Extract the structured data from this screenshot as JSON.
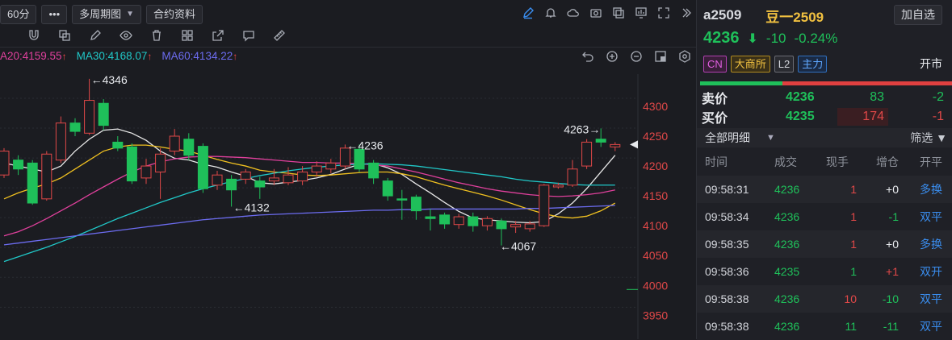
{
  "toolbar": {
    "period": "60分",
    "more": "•••",
    "multi_period": "多周期图",
    "contract_info": "合约资料"
  },
  "ma": [
    {
      "label": "A20:4159.55",
      "color": "#e0409c"
    },
    {
      "label": "MA30:4168.07",
      "color": "#20c8c8"
    },
    {
      "label": "MA60:4134.22",
      "color": "#6c6cf0"
    }
  ],
  "annotations": {
    "high": "←4346",
    "mark_4236": "←4236",
    "mark_4132": "←4132",
    "mark_4067": "←4067",
    "mark_4263": "4263→"
  },
  "chart_data": {
    "type": "candlestick",
    "yticks": [
      4300,
      4250,
      4200,
      4150,
      4100,
      4050,
      4000,
      3950
    ],
    "ylim": [
      3910,
      4362
    ],
    "candles": [
      {
        "o": 4185,
        "c": 4225,
        "h": 4230,
        "l": 4180
      },
      {
        "o": 4210,
        "c": 4195,
        "h": 4218,
        "l": 4185
      },
      {
        "o": 4205,
        "c": 4138,
        "h": 4210,
        "l": 4135
      },
      {
        "o": 4145,
        "c": 4220,
        "h": 4225,
        "l": 4142
      },
      {
        "o": 4210,
        "c": 4272,
        "h": 4283,
        "l": 4205
      },
      {
        "o": 4272,
        "c": 4258,
        "h": 4280,
        "l": 4250
      },
      {
        "o": 4255,
        "c": 4310,
        "h": 4346,
        "l": 4252
      },
      {
        "o": 4305,
        "c": 4268,
        "h": 4312,
        "l": 4260
      },
      {
        "o": 4240,
        "c": 4230,
        "h": 4250,
        "l": 4225
      },
      {
        "o": 4232,
        "c": 4175,
        "h": 4238,
        "l": 4170
      },
      {
        "o": 4180,
        "c": 4200,
        "h": 4212,
        "l": 4170
      },
      {
        "o": 4190,
        "c": 4220,
        "h": 4230,
        "l": 4145
      },
      {
        "o": 4225,
        "c": 4250,
        "h": 4262,
        "l": 4218
      },
      {
        "o": 4245,
        "c": 4218,
        "h": 4255,
        "l": 4210
      },
      {
        "o": 4233,
        "c": 4162,
        "h": 4238,
        "l": 4155
      },
      {
        "o": 4168,
        "c": 4185,
        "h": 4192,
        "l": 4160
      },
      {
        "o": 4178,
        "c": 4160,
        "h": 4185,
        "l": 4132
      },
      {
        "o": 4178,
        "c": 4190,
        "h": 4195,
        "l": 4170
      },
      {
        "o": 4175,
        "c": 4165,
        "h": 4182,
        "l": 4145
      },
      {
        "o": 4175,
        "c": 4180,
        "h": 4195,
        "l": 4168
      },
      {
        "o": 4172,
        "c": 4185,
        "h": 4198,
        "l": 4168
      },
      {
        "o": 4175,
        "c": 4190,
        "h": 4200,
        "l": 4168
      },
      {
        "o": 4190,
        "c": 4200,
        "h": 4208,
        "l": 4182
      },
      {
        "o": 4195,
        "c": 4205,
        "h": 4212,
        "l": 4188
      },
      {
        "o": 4200,
        "c": 4230,
        "h": 4236,
        "l": 4195
      },
      {
        "o": 4228,
        "c": 4195,
        "h": 4236,
        "l": 4190
      },
      {
        "o": 4205,
        "c": 4180,
        "h": 4210,
        "l": 4170
      },
      {
        "o": 4175,
        "c": 4150,
        "h": 4180,
        "l": 4142
      },
      {
        "o": 4145,
        "c": 4143,
        "h": 4160,
        "l": 4110
      },
      {
        "o": 4148,
        "c": 4125,
        "h": 4152,
        "l": 4110
      },
      {
        "o": 4115,
        "c": 4112,
        "h": 4128,
        "l": 4092
      },
      {
        "o": 4118,
        "c": 4103,
        "h": 4122,
        "l": 4095
      },
      {
        "o": 4102,
        "c": 4115,
        "h": 4120,
        "l": 4095
      },
      {
        "o": 4115,
        "c": 4100,
        "h": 4122,
        "l": 4090
      },
      {
        "o": 4100,
        "c": 4112,
        "h": 4116,
        "l": 4092
      },
      {
        "o": 4108,
        "c": 4095,
        "h": 4112,
        "l": 4067
      },
      {
        "o": 4098,
        "c": 4102,
        "h": 4108,
        "l": 4088
      },
      {
        "o": 4095,
        "c": 4103,
        "h": 4108,
        "l": 4090
      },
      {
        "o": 4100,
        "c": 4168,
        "h": 4170,
        "l": 4098
      },
      {
        "o": 4165,
        "c": 4168,
        "h": 4172,
        "l": 4162
      },
      {
        "o": 4168,
        "c": 4195,
        "h": 4210,
        "l": 4165
      },
      {
        "o": 4200,
        "c": 4240,
        "h": 4245,
        "l": 4195
      },
      {
        "o": 4245,
        "c": 4240,
        "h": 4263,
        "l": 4232
      },
      {
        "o": 4232,
        "c": 4236,
        "h": 4240,
        "l": 4225
      }
    ],
    "ma_series": [
      {
        "name": "MA5",
        "color": "#e8e8e8",
        "values": [
          4205,
          4200,
          4195,
          4190,
          4200,
          4225,
          4245,
          4260,
          4262,
          4255,
          4243,
          4225,
          4213,
          4210,
          4203,
          4198,
          4190,
          4183,
          4172,
          4170,
          4173,
          4176,
          4180,
          4186,
          4195,
          4203,
          4204,
          4197,
          4186,
          4170,
          4155,
          4139,
          4124,
          4113,
          4110,
          4108,
          4106,
          4105,
          4107,
          4120,
          4138,
          4162,
          4190,
          4218
        ]
      },
      {
        "name": "MA10",
        "color": "#f0c020",
        "values": [
          4145,
          4155,
          4163,
          4170,
          4180,
          4195,
          4210,
          4225,
          4232,
          4235,
          4235,
          4232,
          4228,
          4225,
          4218,
          4211,
          4205,
          4200,
          4193,
          4190,
          4188,
          4185,
          4184,
          4185,
          4187,
          4189,
          4190,
          4190,
          4187,
          4182,
          4175,
          4168,
          4162,
          4156,
          4150,
          4143,
          4135,
          4127,
          4120,
          4115,
          4113,
          4116,
          4125,
          4138
        ]
      },
      {
        "name": "MA20",
        "color": "#e0409c",
        "values": [
          4083,
          4090,
          4100,
          4112,
          4125,
          4138,
          4152,
          4165,
          4178,
          4190,
          4200,
          4207,
          4212,
          4215,
          4216,
          4216,
          4215,
          4214,
          4212,
          4210,
          4208,
          4206,
          4206,
          4205,
          4205,
          4204,
          4202,
          4200,
          4195,
          4190,
          4184,
          4178,
          4172,
          4167,
          4162,
          4158,
          4155,
          4152,
          4150,
          4149,
          4150,
          4152,
          4155,
          4160
        ]
      },
      {
        "name": "MA30",
        "color": "#20c8c8",
        "values": [
          4040,
          4048,
          4056,
          4064,
          4073,
          4082,
          4092,
          4102,
          4112,
          4121,
          4130,
          4139,
          4147,
          4155,
          4162,
          4168,
          4174,
          4179,
          4184,
          4188,
          4192,
          4195,
          4198,
          4200,
          4202,
          4203,
          4204,
          4203,
          4202,
          4200,
          4197,
          4194,
          4191,
          4188,
          4185,
          4182,
          4178,
          4175,
          4173,
          4171,
          4169,
          4168,
          4168,
          4168
        ]
      },
      {
        "name": "MA60",
        "color": "#6c6cf0",
        "values": [
          4068,
          4071,
          4074,
          4077,
          4080,
          4083,
          4086,
          4089,
          4092,
          4095,
          4098,
          4101,
          4104,
          4107,
          4110,
          4112,
          4114,
          4116,
          4118,
          4119,
          4120,
          4121,
          4122,
          4123,
          4124,
          4125,
          4126,
          4126,
          4127,
          4127,
          4128,
          4128,
          4128,
          4128,
          4128,
          4128,
          4128,
          4129,
          4129,
          4130,
          4131,
          4132,
          4133,
          4134
        ]
      }
    ]
  },
  "side": {
    "code": "a2509",
    "name": "豆一2509",
    "add_watch": "加自选",
    "last_price": "4236",
    "change": "-10",
    "change_pct": "-0.24%",
    "tags": {
      "cn": "CN",
      "exchange": "大商所",
      "level": "L2",
      "main": "主力"
    },
    "market_status": "开市",
    "ask": {
      "label": "卖价",
      "price": "4236",
      "volume": "83",
      "change": "-2"
    },
    "bid": {
      "label": "买价",
      "price": "4235",
      "volume": "174",
      "change": "-1"
    },
    "detail_title": "全部明细",
    "filter_label": "筛选",
    "columns": [
      "时间",
      "成交",
      "现手",
      "增仓",
      "开平"
    ],
    "trades": [
      {
        "time": "09:58:31",
        "price": "4236",
        "qty": "1",
        "oi": "+0",
        "type": "多换",
        "qty_color": "#e04848",
        "oi_color": "#e8eaee",
        "type_color": "#3a8ef0"
      },
      {
        "time": "09:58:34",
        "price": "4236",
        "qty": "1",
        "oi": "-1",
        "type": "双平",
        "qty_color": "#e04848",
        "oi_color": "#1fc05a",
        "type_color": "#3a8ef0"
      },
      {
        "time": "09:58:35",
        "price": "4236",
        "qty": "1",
        "oi": "+0",
        "type": "多换",
        "qty_color": "#e04848",
        "oi_color": "#e8eaee",
        "type_color": "#3a8ef0"
      },
      {
        "time": "09:58:36",
        "price": "4235",
        "qty": "1",
        "oi": "+1",
        "type": "双开",
        "qty_color": "#1fc05a",
        "oi_color": "#e04848",
        "type_color": "#3a8ef0"
      },
      {
        "time": "09:58:38",
        "price": "4236",
        "qty": "10",
        "oi": "-10",
        "type": "双平",
        "qty_color": "#e04848",
        "oi_color": "#1fc05a",
        "type_color": "#3a8ef0"
      },
      {
        "time": "09:58:38",
        "price": "4236",
        "qty": "11",
        "oi": "-11",
        "type": "双平",
        "qty_color": "#1fc05a",
        "oi_color": "#1fc05a",
        "type_color": "#3a8ef0"
      }
    ]
  }
}
